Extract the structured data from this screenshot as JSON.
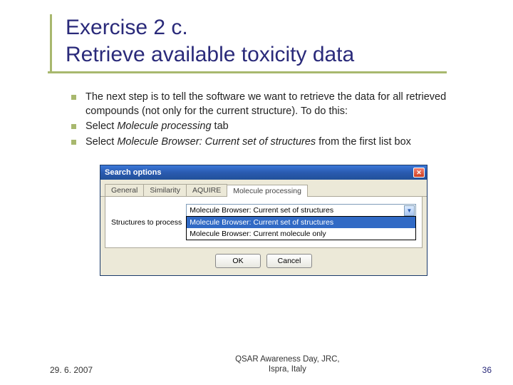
{
  "title_line1": "Exercise 2 c.",
  "title_line2": "Retrieve available toxicity data",
  "bullets": {
    "b1": "The next step is to tell the software we want to retrieve the data for all retrieved compounds (not only for the current structure). To do this:",
    "b2_pre": "Select ",
    "b2_em": "Molecule processing",
    "b2_post": " tab",
    "b3_pre": "Select ",
    "b3_em": "Molecule Browser: Current set of structures",
    "b3_post": " from the first list box"
  },
  "dialog": {
    "title": "Search options",
    "tabs": {
      "t1": "General",
      "t2": "Similarity",
      "t3": "AQUIRE",
      "t4": "Molecule processing"
    },
    "field_label": "Structures to process",
    "selected": "Molecule Browser: Current set of structures",
    "options": {
      "o1": "Molecule Browser: Current set of structures",
      "o2": "Molecule Browser: Current molecule only"
    },
    "ok": "OK",
    "cancel": "Cancel"
  },
  "footer": {
    "date": "29. 6. 2007",
    "venue_l1": "QSAR Awareness Day, JRC,",
    "venue_l2": "Ispra, Italy",
    "page": "36"
  }
}
